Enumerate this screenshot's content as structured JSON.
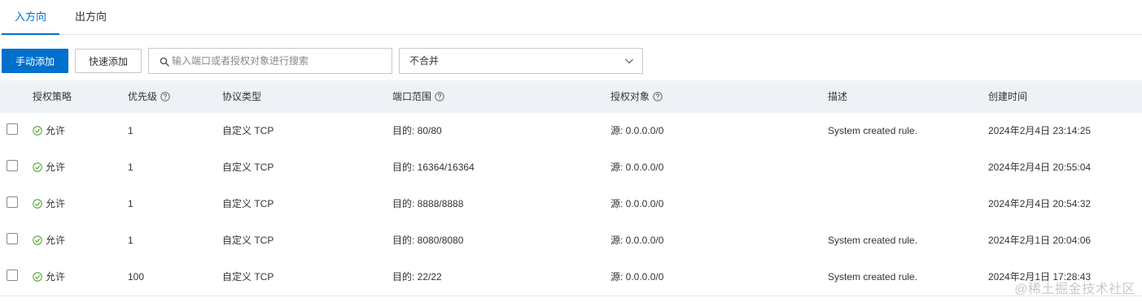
{
  "tabs": [
    {
      "label": "入方向",
      "active": true
    },
    {
      "label": "出方向",
      "active": false
    }
  ],
  "toolbar": {
    "add_manual_label": "手动添加",
    "quick_add_label": "快速添加",
    "search_placeholder": "输入端口或者授权对象进行搜索",
    "merge_select_value": "不合并"
  },
  "table": {
    "headers": {
      "policy": "授权策略",
      "priority": "优先级",
      "protocol": "协议类型",
      "port_range": "端口范围",
      "auth_object": "授权对象",
      "description": "描述",
      "created": "创建时间"
    },
    "rows": [
      {
        "policy": "允许",
        "priority": "1",
        "protocol": "自定义 TCP",
        "port_range": "目的: 80/80",
        "auth_object": "源: 0.0.0.0/0",
        "description": "System created rule.",
        "created": "2024年2月4日 23:14:25"
      },
      {
        "policy": "允许",
        "priority": "1",
        "protocol": "自定义 TCP",
        "port_range": "目的: 16364/16364",
        "auth_object": "源: 0.0.0.0/0",
        "description": "",
        "created": "2024年2月4日 20:55:04"
      },
      {
        "policy": "允许",
        "priority": "1",
        "protocol": "自定义 TCP",
        "port_range": "目的: 8888/8888",
        "auth_object": "源: 0.0.0.0/0",
        "description": "",
        "created": "2024年2月4日 20:54:32"
      },
      {
        "policy": "允许",
        "priority": "1",
        "protocol": "自定义 TCP",
        "port_range": "目的: 8080/8080",
        "auth_object": "源: 0.0.0.0/0",
        "description": "System created rule.",
        "created": "2024年2月1日 20:04:06"
      },
      {
        "policy": "允许",
        "priority": "100",
        "protocol": "自定义 TCP",
        "port_range": "目的: 22/22",
        "auth_object": "源: 0.0.0.0/0",
        "description": "System created rule.",
        "created": "2024年2月1日 17:28:43"
      }
    ]
  },
  "watermark": "@稀土掘金技术社区",
  "colors": {
    "accent": "#0070cc",
    "allow_green": "#52a832",
    "header_bg": "#eef1f5"
  },
  "icons": {
    "search": "search-icon",
    "dropdown": "chevron-down-icon",
    "help": "help-icon",
    "allow": "check-circle-icon"
  }
}
